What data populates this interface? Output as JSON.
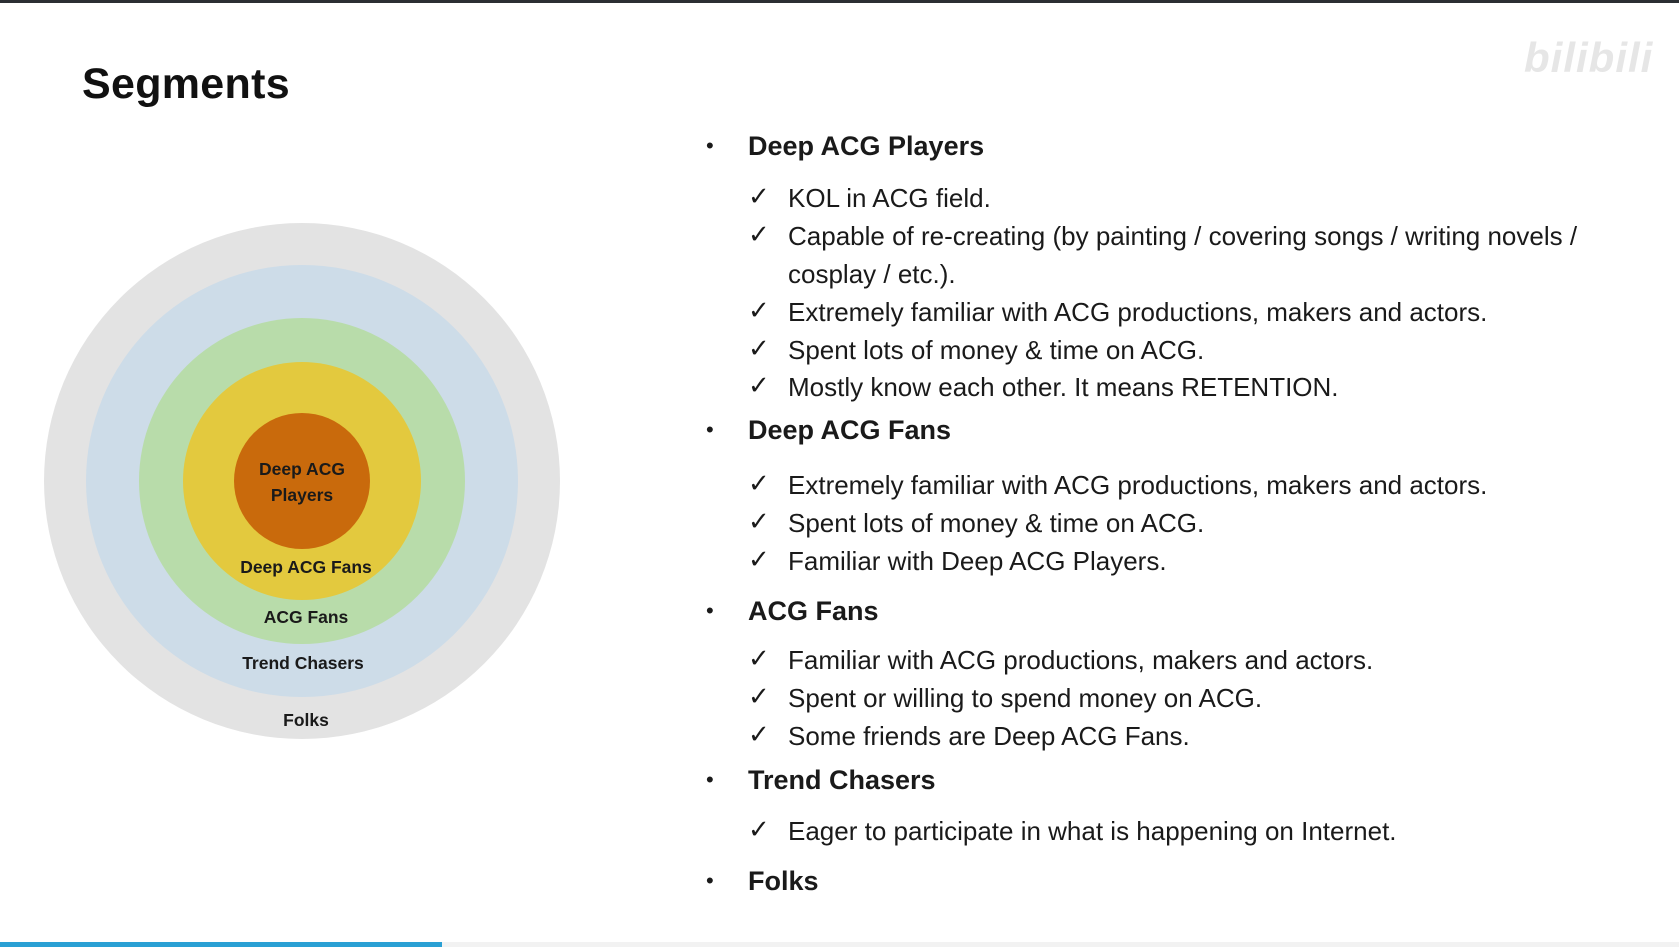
{
  "slide": {
    "title": "Segments"
  },
  "watermark": "bilibili",
  "rings": [
    {
      "label": "Folks",
      "color": "#e3e3e3"
    },
    {
      "label": "Trend Chasers",
      "color": "#cddce8"
    },
    {
      "label": "ACG Fans",
      "color": "#b8dcaa"
    },
    {
      "label": "Deep ACG Fans",
      "color": "#e3c93e"
    },
    {
      "label_line1": "Deep ACG",
      "label_line2": "Players",
      "color": "#c96a0c"
    }
  ],
  "check_glyph": "✓",
  "bullet_glyph": "•",
  "segments": [
    {
      "heading": "Deep ACG Players",
      "items": [
        "KOL in ACG field.",
        "Capable of re-creating (by painting / covering songs / writing novels /",
        "cosplay / etc.).",
        "Extremely familiar with ACG productions, makers and actors.",
        "Spent lots of money & time on ACG.",
        "Mostly know each other. It means RETENTION."
      ]
    },
    {
      "heading": "Deep ACG Fans",
      "items": [
        "Extremely familiar with ACG productions, makers and actors.",
        "Spent lots of money & time on ACG.",
        "Familiar with Deep ACG Players."
      ]
    },
    {
      "heading": "ACG Fans",
      "items": [
        "Familiar with ACG productions, makers and actors.",
        "Spent or willing to spend money on ACG.",
        "Some friends are Deep ACG Fans."
      ]
    },
    {
      "heading": "Trend Chasers",
      "items": [
        "Eager to participate in what is happening on Internet."
      ]
    },
    {
      "heading": "Folks",
      "items": []
    }
  ],
  "video_progress": 0.263
}
